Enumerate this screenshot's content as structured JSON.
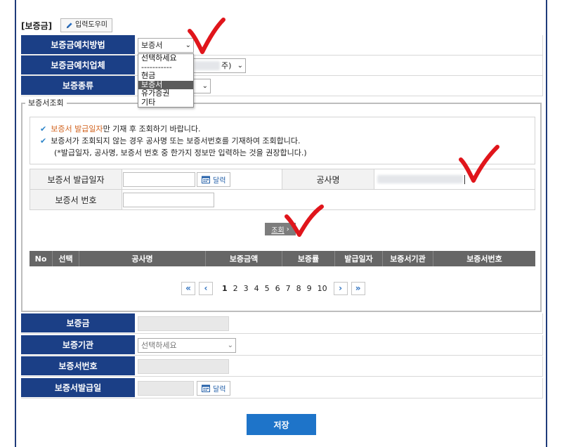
{
  "header": {
    "section_title": "[보증금]",
    "helper_button": "입력도우미"
  },
  "form_top": {
    "deposit_method": {
      "label": "보증금예치방법",
      "value": "보증서"
    },
    "deposit_company": {
      "label": "보증금예치업체",
      "value_suffix": "주)"
    },
    "deposit_type": {
      "label": "보증종류"
    }
  },
  "dropdown": {
    "options": [
      "선택하세요",
      "-----------",
      "현금",
      "보증서",
      "유가증권",
      "기타"
    ],
    "selected": "보증서"
  },
  "search_panel": {
    "legend": "보증서조회",
    "notice_1_highlight": "보증서 발급일자",
    "notice_1_rest": "만 기재 후 조회하기 바랍니다.",
    "notice_2": "보증서가 조회되지 않는 경우 공사명 또는 보증서번호를 기재하여 조회합니다.",
    "notice_3": "(*발급일자, 공사명, 보증서 번호 중 한가지 정보만 입력하는 것을 권장합니다.)",
    "issue_date_label": "보증서 발급일자",
    "calendar_label": "달력",
    "project_name_label": "공사명",
    "cert_number_label": "보증서 번호",
    "search_button": "조회"
  },
  "table": {
    "columns": [
      "No",
      "선택",
      "공사명",
      "보증금액",
      "보증률",
      "발급일자",
      "보증서기관",
      "보증서번호"
    ]
  },
  "pagination": {
    "first": "«",
    "prev": "‹",
    "pages": [
      "1",
      "2",
      "3",
      "4",
      "5",
      "6",
      "7",
      "8",
      "9",
      "10"
    ],
    "current": "1",
    "next": "›",
    "last": "»"
  },
  "form_bottom": {
    "deposit_amount": {
      "label": "보증금"
    },
    "guarantor": {
      "label": "보증기관",
      "placeholder": "선택하세요"
    },
    "cert_number": {
      "label": "보증서번호"
    },
    "cert_issue_date": {
      "label": "보증서발급일",
      "calendar_label": "달력"
    }
  },
  "save_button": "저장",
  "colors": {
    "header_blue": "#1b3f86",
    "save_blue": "#1e74c9",
    "checkmark_red": "#e0151b",
    "notice_check": "#2c84c9",
    "highlight_orange": "#d2631e"
  }
}
